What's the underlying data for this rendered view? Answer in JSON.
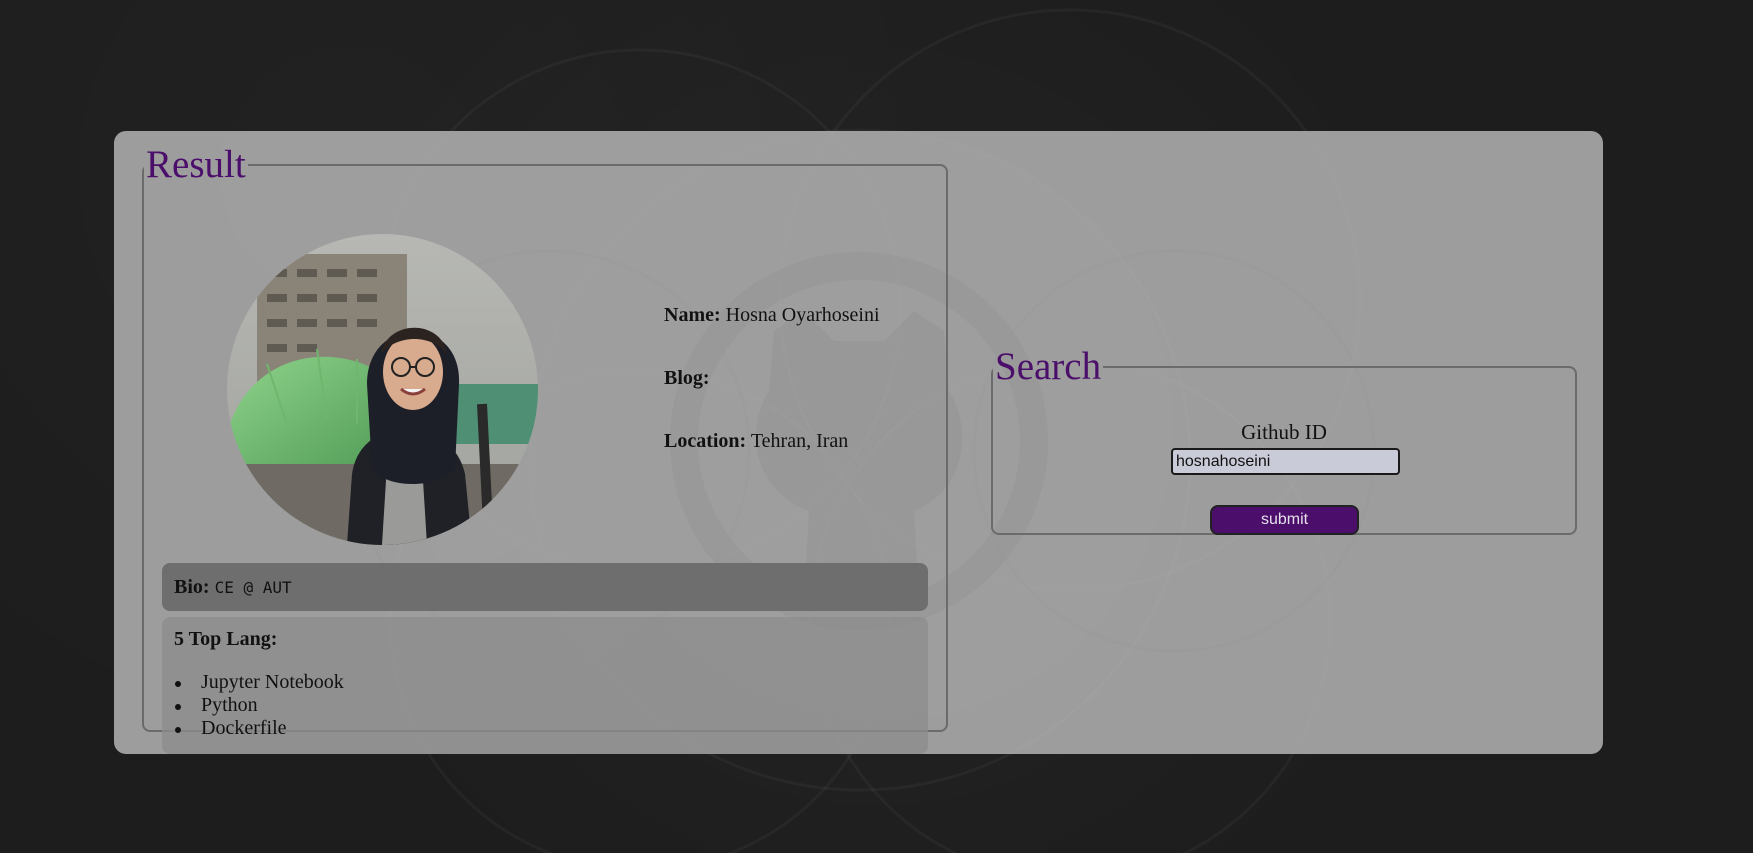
{
  "colors": {
    "accent": "#4b0e6b",
    "page_background": "#1d1d1d",
    "card_background": "#b9b9b9",
    "bio_background": "#6e6e6e"
  },
  "result": {
    "legend": "Result",
    "avatar_icon": "profile-photo",
    "name_label": "Name:",
    "name_value": "Hosna Oyarhoseini",
    "blog_label": "Blog:",
    "blog_value": "",
    "location_label": "Location:",
    "location_value": "Tehran, Iran",
    "bio_label": "Bio:",
    "bio_value": "CE @ AUT",
    "langs_title": "5 Top Lang:",
    "langs": [
      "Jupyter Notebook",
      "Python",
      "Dockerfile"
    ]
  },
  "search": {
    "legend": "Search",
    "field_label": "Github ID",
    "field_value": "hosnahoseini",
    "submit_label": "submit"
  }
}
